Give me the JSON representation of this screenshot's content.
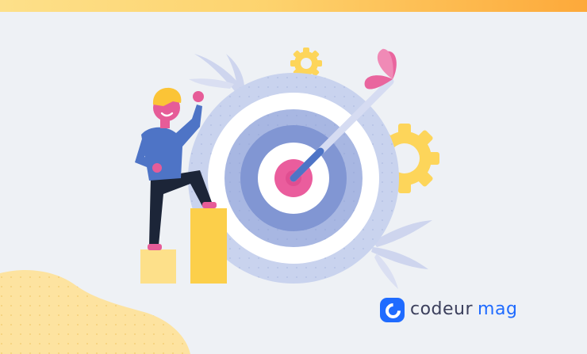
{
  "brand": {
    "name_part1": "codeur",
    "name_part2": "mag",
    "logo_icon": "codeur-c-logo-icon"
  },
  "colors": {
    "background": "#eef1f5",
    "top_bar_start": "#fde08a",
    "top_bar_end": "#fda93a",
    "brand_blue": "#1f6bff",
    "brand_dark": "#3b3f5c",
    "target_light": "#c9d3ee",
    "target_mid": "#a8b7e2",
    "target_dark": "#8196d3",
    "bullseye_pink": "#ea5d9d",
    "arrow_pink": "#e9659e",
    "gear_yellow": "#fdd55a",
    "block_yellow": "#fccf4a",
    "blob_yellow": "#fde3a0",
    "person_shirt": "#4e74c6",
    "person_pants": "#1c2538",
    "person_hair": "#fbc436",
    "person_skin": "#e65c98"
  },
  "illustration": {
    "subject": "person-climbing-steps-next-to-target-with-arrow",
    "icons": [
      "target-icon",
      "arrow-icon",
      "gear-icon",
      "leaf-icon",
      "person-icon",
      "step-block-icon"
    ]
  }
}
